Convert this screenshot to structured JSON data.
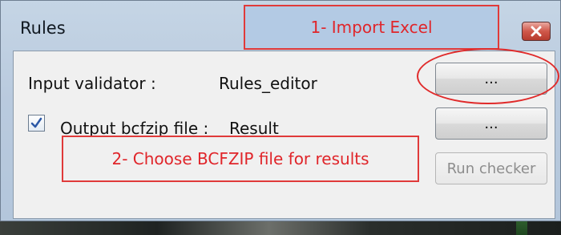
{
  "window": {
    "title": "Rules",
    "close_icon": "close-icon"
  },
  "rows": {
    "input_validator_label": "Input validator :",
    "input_validator_value": "Rules_editor",
    "browse_input_label": "...",
    "output_checkbox_checked": true,
    "output_label": "Output bcfzip file :",
    "output_value": "Result",
    "browse_output_label": "...",
    "run_checker_label": "Run checker"
  },
  "annotations": {
    "step1": "1- Import Excel",
    "step2": "2-   Choose BCFZIP file for results"
  },
  "colors": {
    "annotation_red": "#e0252a",
    "window_blue": "#b9cade",
    "close_red": "#d0584a"
  }
}
